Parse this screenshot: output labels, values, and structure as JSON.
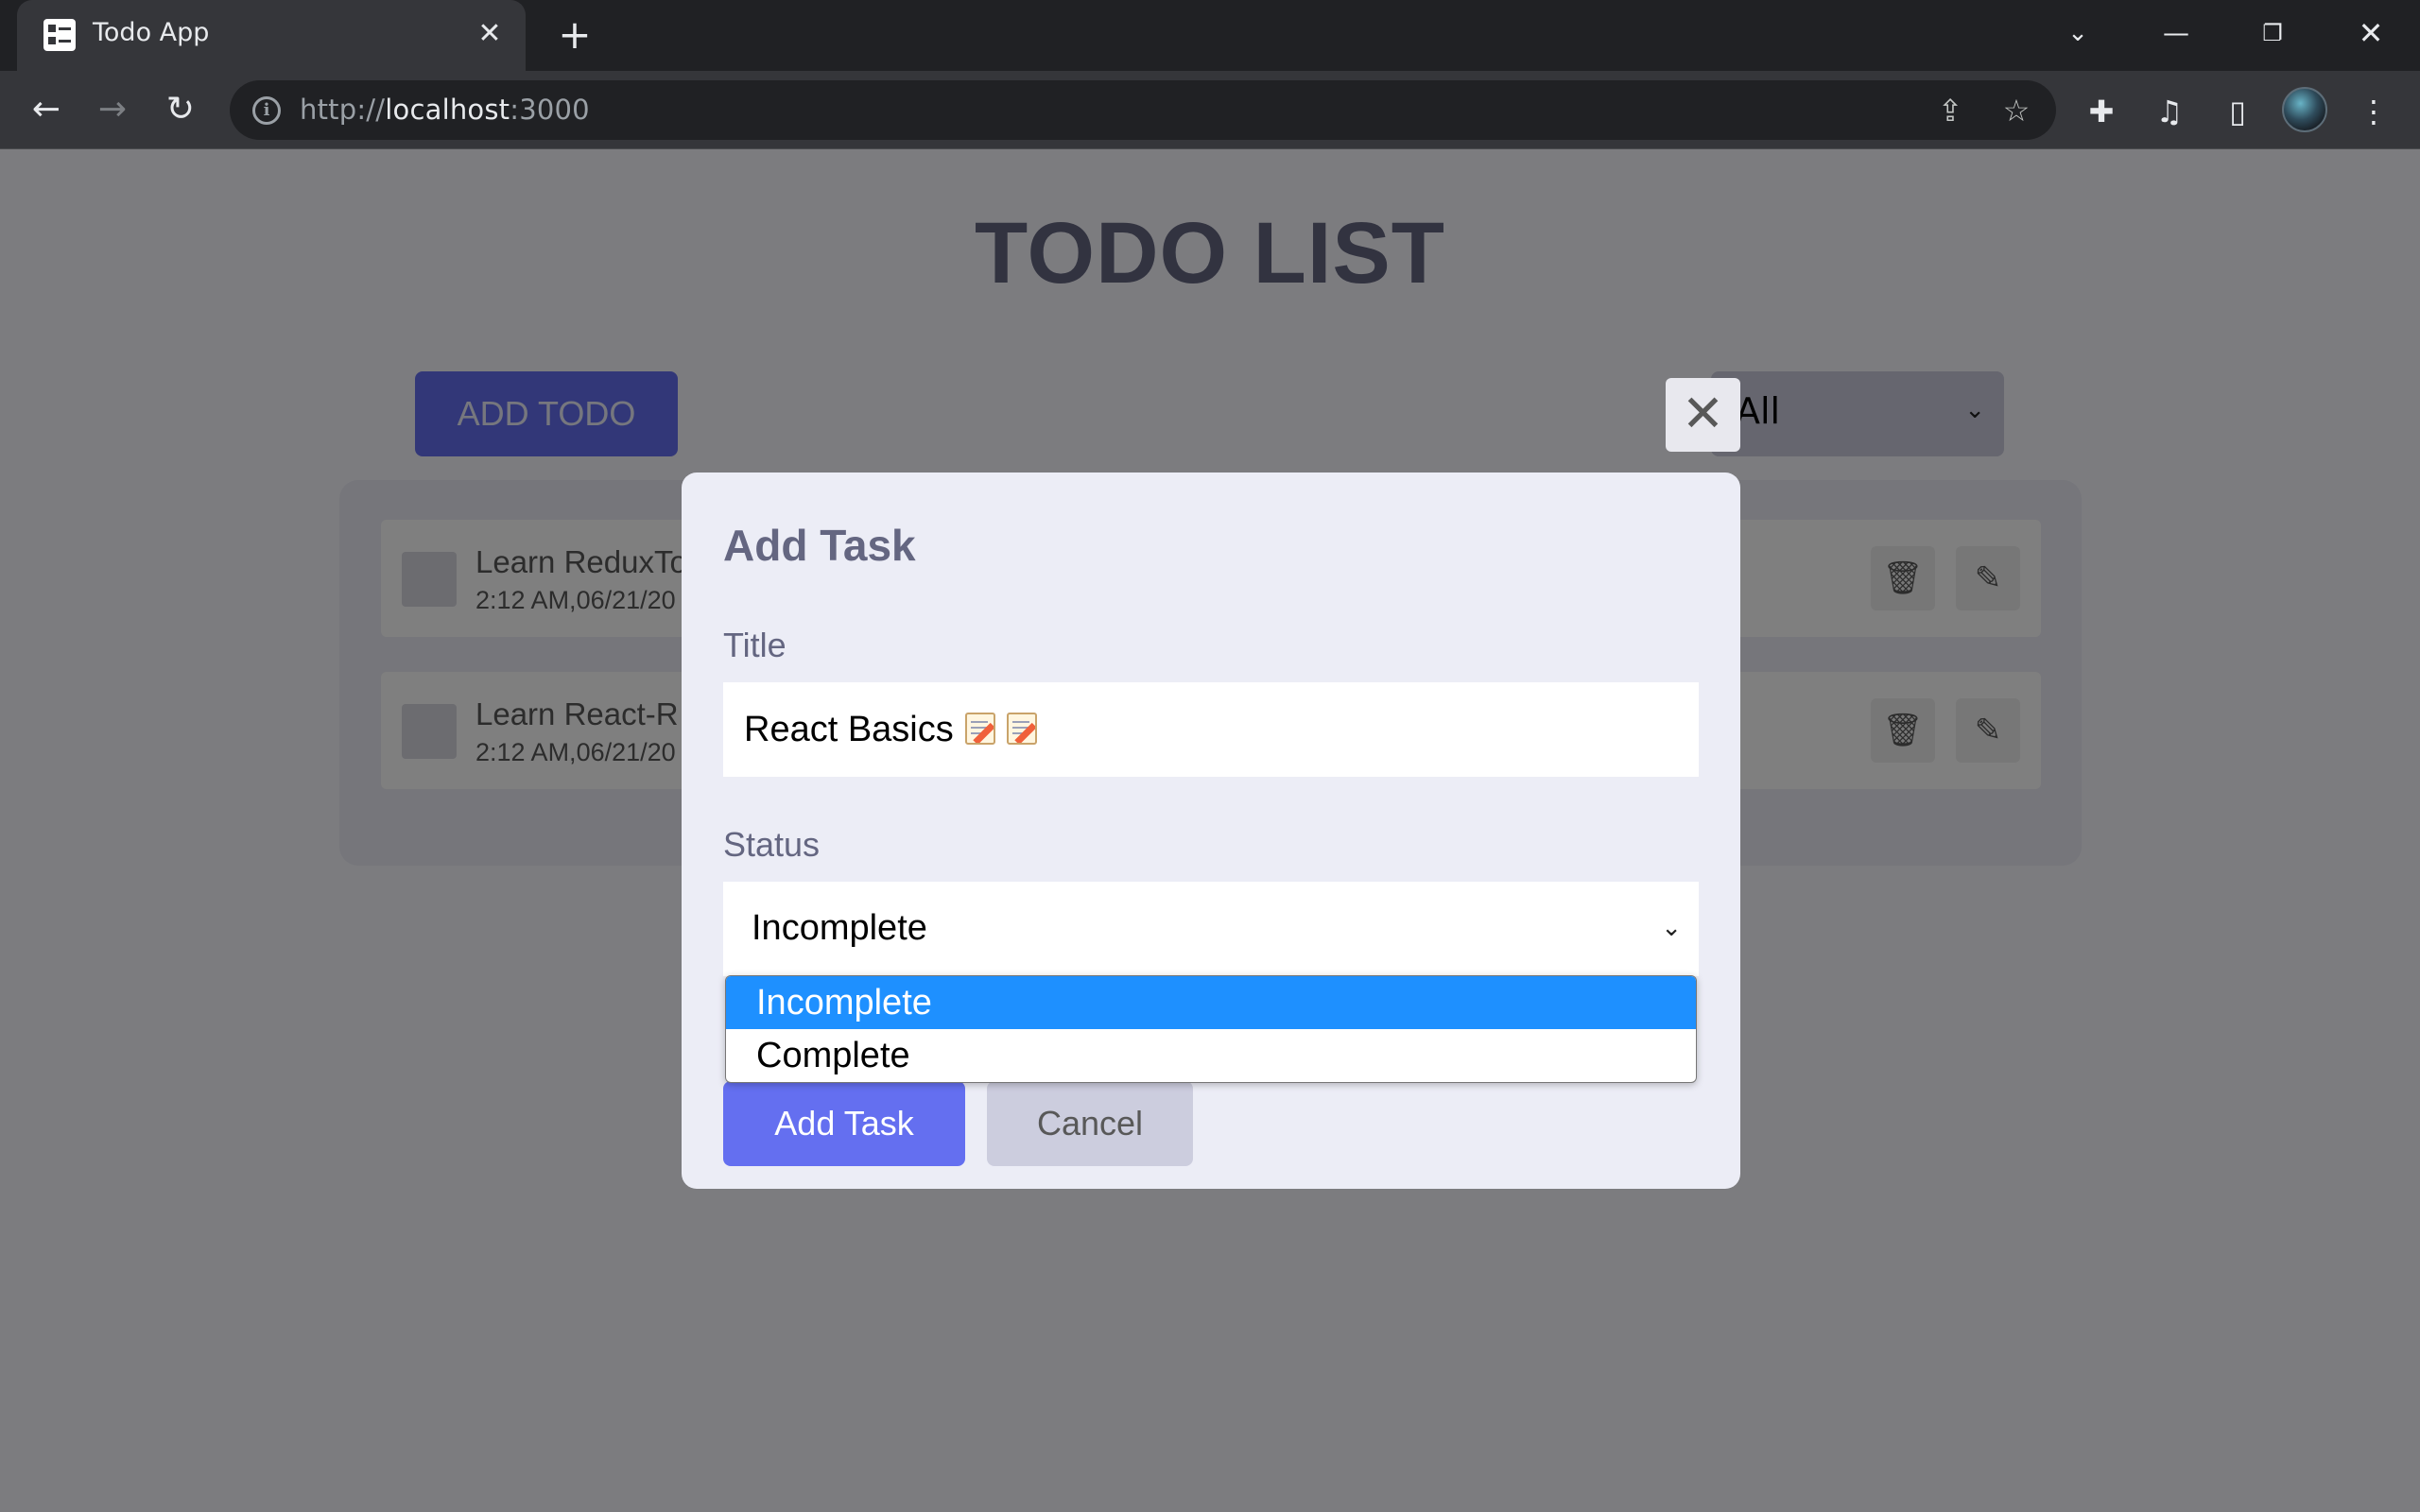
{
  "browser": {
    "tab_title": "Todo App",
    "url_scheme": "http://",
    "url_host": "localhost",
    "url_port": ":3000"
  },
  "page": {
    "title": "TODO LIST",
    "add_todo_label": "ADD TODO",
    "filter_value": "All",
    "todos": [
      {
        "title": "Learn ReduxTo",
        "time": "2:12 AM,06/21/20"
      },
      {
        "title": "Learn React-R",
        "time": "2:12 AM,06/21/20"
      }
    ]
  },
  "modal": {
    "heading": "Add Task",
    "title_label": "Title",
    "title_value": "React Basics",
    "status_label": "Status",
    "status_value": "Incomplete",
    "status_options": [
      "Incomplete",
      "Complete"
    ],
    "submit_label": "Add Task",
    "cancel_label": "Cancel"
  },
  "colors": {
    "primary": "#646ff0",
    "secondary": "#cccdde",
    "dropdown_highlight": "#1e90ff",
    "heading": "#646681"
  }
}
